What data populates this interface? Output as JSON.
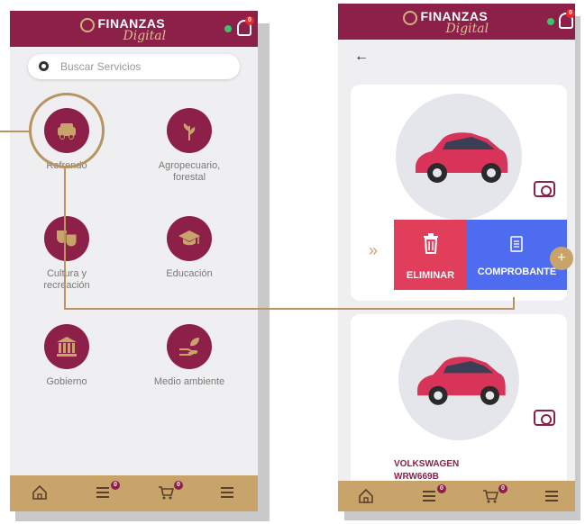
{
  "brand": {
    "title": "FINANZAS",
    "subtitle": "Digital"
  },
  "header": {
    "notification_count": "0"
  },
  "search": {
    "placeholder": "Buscar Servicios"
  },
  "services": [
    {
      "label": "Refrendo",
      "icon": "car-icon"
    },
    {
      "label": "Agropecuario, forestal",
      "icon": "plant-icon"
    },
    {
      "label": "Cultura y recreación",
      "icon": "theater-masks-icon"
    },
    {
      "label": "Educación",
      "icon": "graduation-cap-icon"
    },
    {
      "label": "Gobierno",
      "icon": "government-building-icon"
    },
    {
      "label": "Medio ambiente",
      "icon": "hand-leaf-icon"
    }
  ],
  "bottom_nav": {
    "list_badge": "0",
    "cart_badge": "0"
  },
  "vehicle_detail": {
    "delete_label": "ELIMINAR",
    "receipt_label": "COMPROBANTE",
    "fab_label": "+",
    "brand": "VOLKSWAGEN",
    "plate": "WRW669B"
  },
  "colors": {
    "primary": "#8c2049",
    "gold": "#c9a46a",
    "delete": "#e03e5a",
    "receipt": "#4e6cf0"
  }
}
